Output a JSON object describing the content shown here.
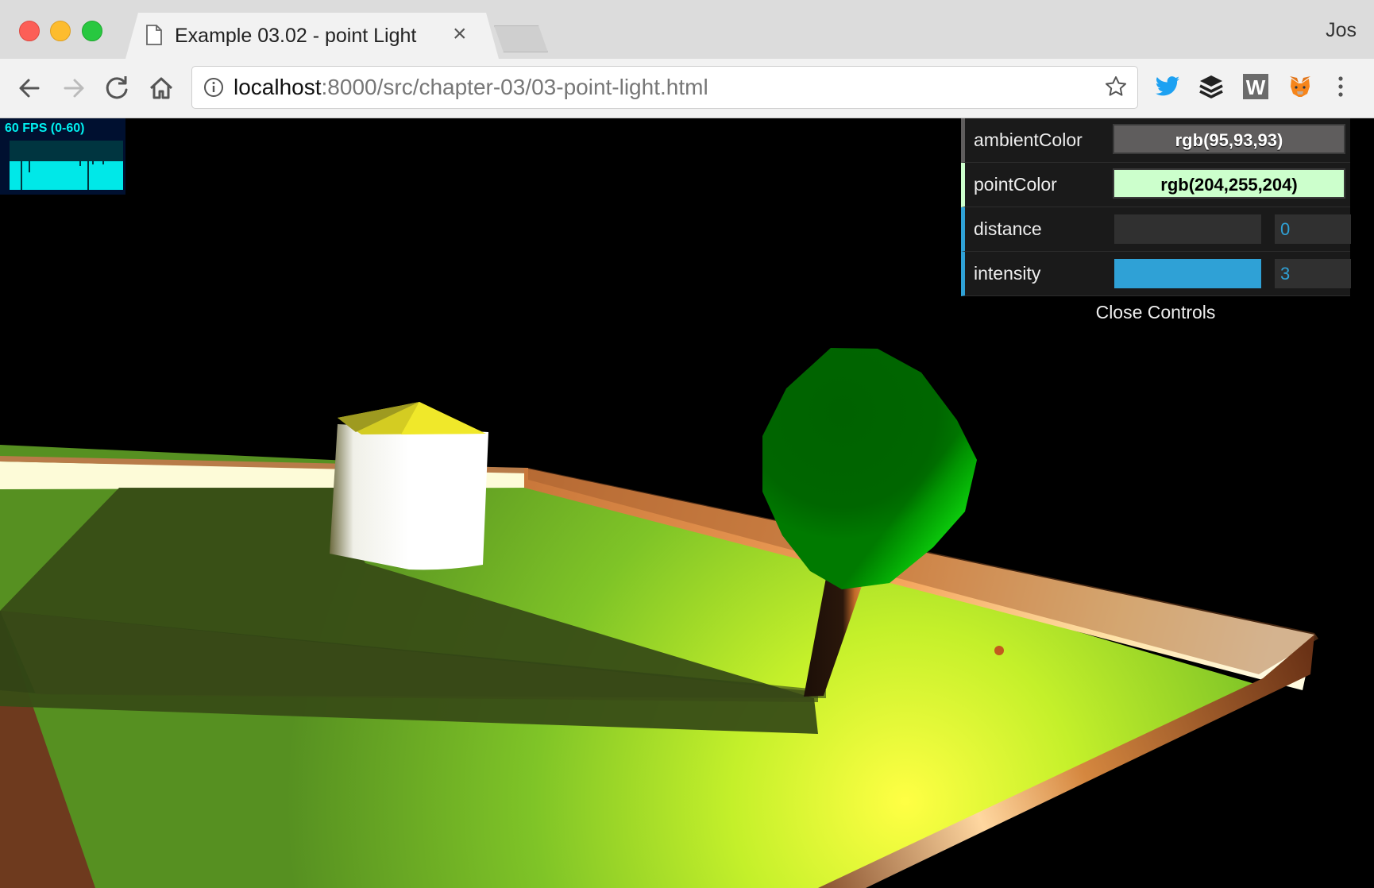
{
  "browser": {
    "tab_title": "Example 03.02 - point Light",
    "profile_name": "Jos",
    "url_host": "localhost",
    "url_path": ":8000/src/chapter-03/03-point-light.html"
  },
  "stats": {
    "fps_text": "60 FPS (0-60)"
  },
  "gui": {
    "controls": [
      {
        "label": "ambientColor",
        "value": "rgb(95,93,93)",
        "type": "color",
        "color": "#5f5d5d"
      },
      {
        "label": "pointColor",
        "value": "rgb(204,255,204)",
        "type": "color",
        "color": "#ccffcc"
      },
      {
        "label": "distance",
        "value": "0",
        "type": "number"
      },
      {
        "label": "intensity",
        "value": "3",
        "type": "number"
      }
    ],
    "close_label": "Close Controls"
  },
  "colors": {
    "accent": "#2fa1d6",
    "fps": "#00f0f0"
  }
}
